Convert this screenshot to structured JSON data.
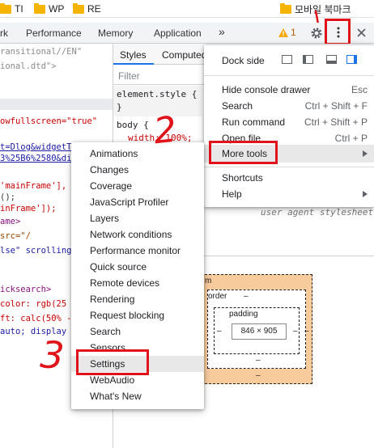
{
  "bookmarks": [
    {
      "label": "TI"
    },
    {
      "label": "WP"
    },
    {
      "label": "RE"
    },
    {
      "label": "모바일 북마크"
    }
  ],
  "devtools": {
    "tabs": [
      "rk",
      "Performance",
      "Memory",
      "Application",
      "»"
    ],
    "warning_count": "1"
  },
  "source_lines": [
    "ransitional//EN\"",
    "ional.dtd\">",
    "",
    "",
    "",
    "owfullscreen=\"true\"",
    "",
    "",
    "t=Dlog&widgetT",
    "3%25B6%2580&di",
    "",
    "'mainFrame'],",
    "();",
    "inFrame']);",
    "ame>",
    " src=\"/",
    "lse\" scrolling",
    "",
    "",
    "",
    "icksearch>",
    "color: rgb(25",
    "ft: calc(50% -",
    " auto; display"
  ],
  "styles": {
    "tabs": [
      "Styles",
      "Computed"
    ],
    "filter_placeholder": "Filter",
    "element_style": "element.style {",
    "element_close": "}",
    "body_selector": "body {",
    "width_prop": "width: 100%;",
    "ua_label": "user agent stylesheet",
    "box": {
      "margin": "m",
      "border": "order",
      "padding": "padding",
      "content": "846 × 905",
      "dash": "–"
    }
  },
  "main_menu": {
    "dock_label": "Dock side",
    "items": [
      {
        "label": "Hide console drawer",
        "shortcut": "Esc"
      },
      {
        "label": "Search",
        "shortcut": "Ctrl + Shift + F"
      },
      {
        "label": "Run command",
        "shortcut": "Ctrl + Shift + P"
      },
      {
        "label": "Open file",
        "shortcut": "Ctrl + P"
      },
      {
        "label": "More tools",
        "shortcut": ""
      },
      {
        "label": "Shortcuts",
        "shortcut": ""
      },
      {
        "label": "Help",
        "shortcut": ""
      }
    ]
  },
  "more_tools_menu": {
    "items": [
      "Animations",
      "Changes",
      "Coverage",
      "JavaScript Profiler",
      "Layers",
      "Network conditions",
      "Performance monitor",
      "Quick source",
      "Remote devices",
      "Rendering",
      "Request blocking",
      "Search",
      "Sensors",
      "Settings",
      "WebAudio",
      "What's New"
    ]
  },
  "annotations": {
    "step2": "2",
    "step3": "3"
  },
  "colors": {
    "highlight_red": "#e0121a",
    "folder": "#f5b400",
    "selected_dock": "#1a73e8"
  }
}
